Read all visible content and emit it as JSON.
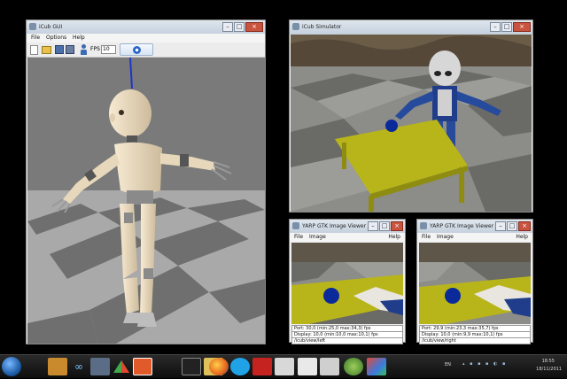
{
  "left_window": {
    "title": "iCub GUI",
    "menu": [
      "File",
      "Options",
      "Help"
    ],
    "fps_label": "FPS",
    "fps_value": "10"
  },
  "simulator_window": {
    "title": "iCub Simulator"
  },
  "viewer_left": {
    "title": "YARP GTK Image Viewer",
    "menu": [
      "File",
      "Image"
    ],
    "help": "Help",
    "port_line": "Port: 30,0 (min:25,0 max:34,3) fps",
    "display_line": "Display: 10,0 (min:10,0 max:10,1) fps",
    "path": "/icub/view/left"
  },
  "viewer_right": {
    "title": "YARP GTK Image Viewer",
    "menu": [
      "File",
      "Image"
    ],
    "help": "Help",
    "port_line": "Port: 29,9 (min:23,3 max:35,7) fps",
    "display_line": "Display: 10,0 (min:9,9 max:10,1) fps",
    "path": "/icub/view/right"
  },
  "taskbar": {
    "lang": "EN",
    "time": "18:55",
    "date": "18/11/2011"
  },
  "icons": [
    "start-orb-icon",
    "media-icon",
    "infinity-icon",
    "network-icon",
    "triangle-app-icon",
    "pdf-icon",
    "terminal-icon",
    "folder-icon",
    "firefox-icon",
    "skype-icon",
    "acrobat-icon",
    "window-icon",
    "people-icon",
    "window2-icon",
    "globe-icon",
    "cube-icon"
  ],
  "colors": {
    "desktop": "#000000",
    "table": "#b8b51a",
    "ball": "#0a2a9a",
    "robot_body": "#ecdcc0"
  }
}
